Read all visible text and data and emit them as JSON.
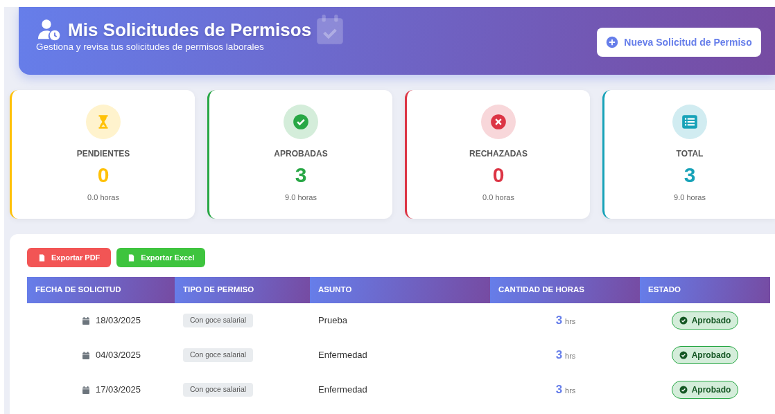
{
  "header": {
    "title": "Mis Solicitudes de Permisos",
    "subtitle": "Gestiona y revisa tus solicitudes de permisos laborales",
    "new_button": "Nueva Solicitud de Permiso"
  },
  "stats": [
    {
      "kind": "pending",
      "label": "PENDIENTES",
      "value": "0",
      "hours": "0.0 horas",
      "color": "#ffc107"
    },
    {
      "kind": "approved",
      "label": "APROBADAS",
      "value": "3",
      "hours": "9.0 horas",
      "color": "#28a745"
    },
    {
      "kind": "rejected",
      "label": "RECHAZADAS",
      "value": "0",
      "hours": "0.0 horas",
      "color": "#dc3545"
    },
    {
      "kind": "total",
      "label": "TOTAL",
      "value": "3",
      "hours": "9.0 horas",
      "color": "#17a2b8"
    }
  ],
  "export_buttons": [
    {
      "kind": "pdf",
      "label": "Exportar PDF"
    },
    {
      "kind": "excel",
      "label": "Exportar Excel"
    }
  ],
  "table": {
    "columns": [
      "FECHA DE SOLICITUD",
      "TIPO DE PERMISO",
      "ASUNTO",
      "CANTIDAD DE HORAS",
      "ESTADO"
    ],
    "rows": [
      {
        "date": "18/03/2025",
        "type": "Con goce salarial",
        "subject": "Prueba",
        "hours": "3",
        "hours_unit": "hrs",
        "status": "Aprobado",
        "approved": true
      },
      {
        "date": "04/03/2025",
        "type": "Con goce salarial",
        "subject": "Enfermedad",
        "hours": "3",
        "hours_unit": "hrs",
        "status": "Aprobado",
        "approved": true
      },
      {
        "date": "17/03/2025",
        "type": "Con goce salarial",
        "subject": "Enfermedad",
        "hours": "3",
        "hours_unit": "hrs",
        "status": "Aprobado",
        "approved": true
      }
    ]
  }
}
